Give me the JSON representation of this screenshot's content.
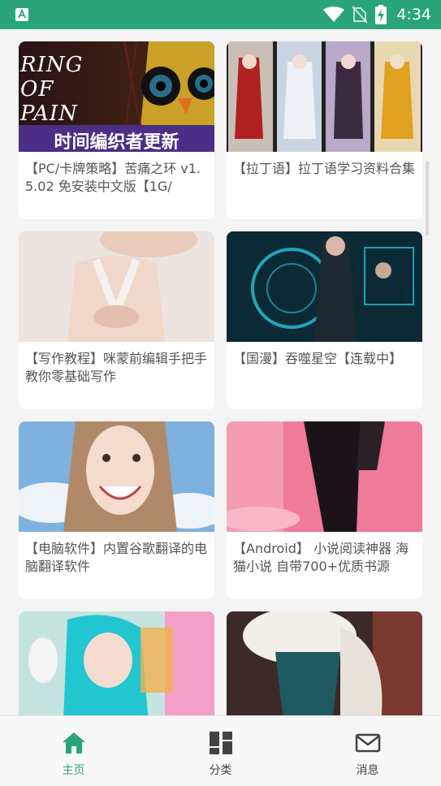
{
  "status_bar": {
    "time": "4:34",
    "icons": [
      "app-notification-icon",
      "wifi-icon",
      "no-sim-icon",
      "battery-charging-icon"
    ]
  },
  "cards": [
    {
      "title": "【PC/卡牌策略】苦痛之环 v1.5.02 免安装中文版【1G/",
      "thumb_caption": "时间编织者更新",
      "thumb_logo": "RING OF PAIN"
    },
    {
      "title": "【拉丁语】拉丁语学习资料合集"
    },
    {
      "title": "【写作教程】咪蒙前编辑手把手教你零基础写作"
    },
    {
      "title": "【国漫】吞噬星空【连载中】"
    },
    {
      "title": "【电脑软件】内置谷歌翻译的电脑翻译软件"
    },
    {
      "title": "【Android】 小说阅读神器 海猫小说 自带700+优质书源"
    },
    {
      "title": ""
    },
    {
      "title": ""
    }
  ],
  "bottom_nav": {
    "items": [
      {
        "label": "主页",
        "icon": "home-icon",
        "active": true
      },
      {
        "label": "分类",
        "icon": "category-grid-icon",
        "active": false
      },
      {
        "label": "消息",
        "icon": "mail-icon",
        "active": false
      }
    ]
  },
  "colors": {
    "accent": "#2aa57a",
    "inactive": "#444444"
  }
}
